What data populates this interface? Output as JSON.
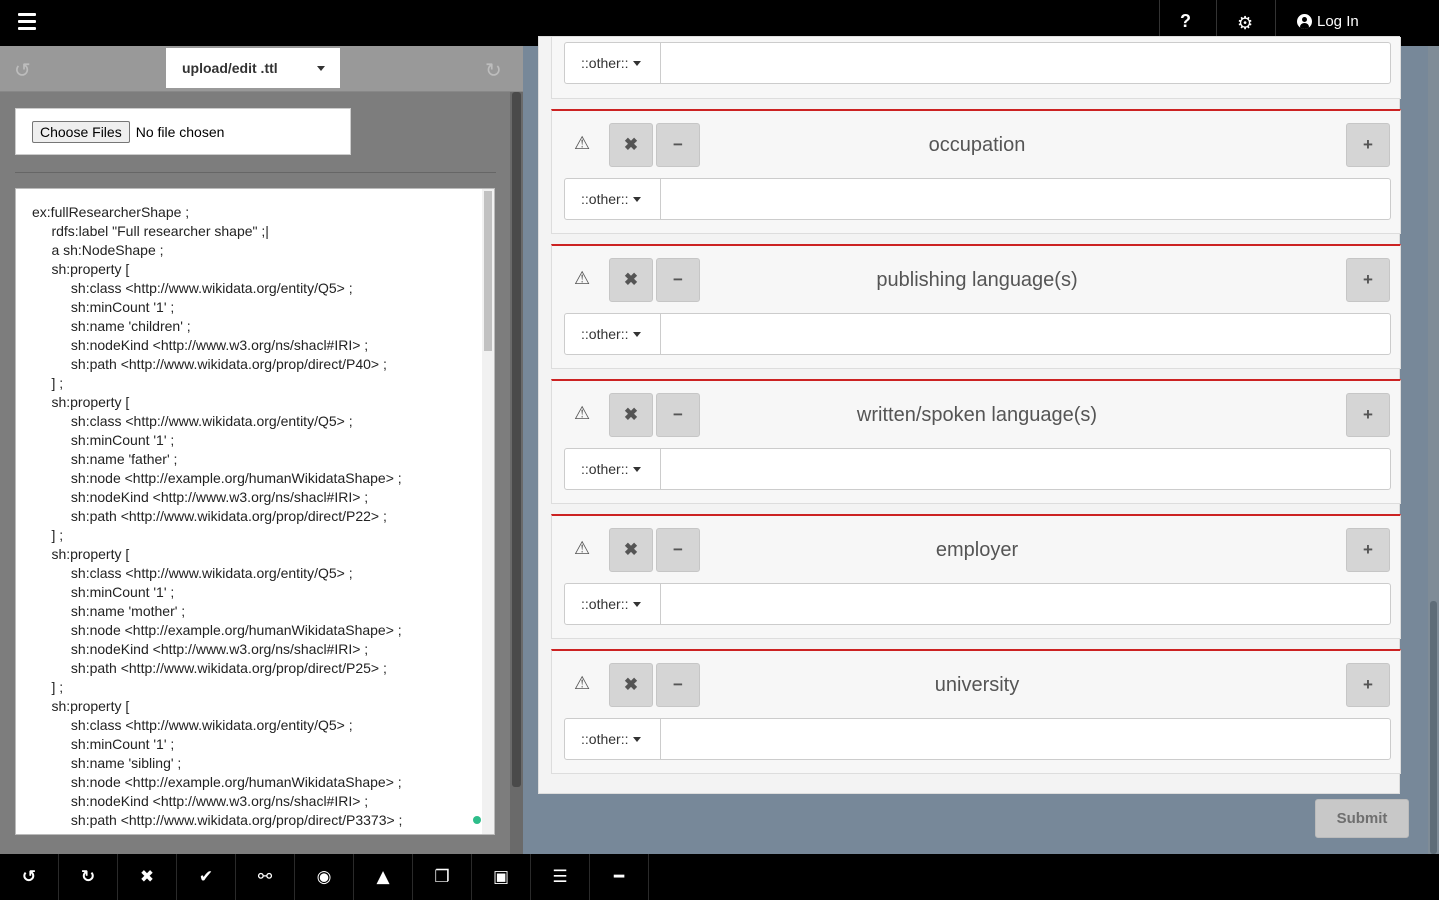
{
  "topbar": {
    "help_label": "?",
    "gear_icon": "⚙",
    "login_label": "Log In"
  },
  "left_panel": {
    "undo_icon": "↺",
    "redo_icon": "↻",
    "file_format": "upload/edit .ttl",
    "file_input_button": "Choose Files",
    "file_input_status": "No file chosen",
    "editor_text": "ex:fullResearcherShape ;\n\trdfs:label \"Full researcher shape\" ;|\n\ta sh:NodeShape ;\n\tsh:property [\n\t\tsh:class <http://www.wikidata.org/entity/Q5> ;\n\t\tsh:minCount '1' ;\n\t\tsh:name 'children' ;\n\t\tsh:nodeKind <http://www.w3.org/ns/shacl#IRI> ;\n\t\tsh:path <http://www.wikidata.org/prop/direct/P40> ;\n\t] ;\n\tsh:property [\n\t\tsh:class <http://www.wikidata.org/entity/Q5> ;\n\t\tsh:minCount '1' ;\n\t\tsh:name 'father' ;\n\t\tsh:node <http://example.org/humanWikidataShape> ;\n\t\tsh:nodeKind <http://www.w3.org/ns/shacl#IRI> ;\n\t\tsh:path <http://www.wikidata.org/prop/direct/P22> ;\n\t] ;\n\tsh:property [\n\t\tsh:class <http://www.wikidata.org/entity/Q5> ;\n\t\tsh:minCount '1' ;\n\t\tsh:name 'mother' ;\n\t\tsh:node <http://example.org/humanWikidataShape> ;\n\t\tsh:nodeKind <http://www.w3.org/ns/shacl#IRI> ;\n\t\tsh:path <http://www.wikidata.org/prop/direct/P25> ;\n\t] ;\n\tsh:property [\n\t\tsh:class <http://www.wikidata.org/entity/Q5> ;\n\t\tsh:minCount '1' ;\n\t\tsh:name 'sibling' ;\n\t\tsh:node <http://example.org/humanWikidataShape> ;\n\t\tsh:nodeKind <http://www.w3.org/ns/shacl#IRI> ;\n\t\tsh:path <http://www.wikidata.org/prop/direct/P3373> ;\n\t] ;"
  },
  "form": {
    "properties": [
      {
        "title": "",
        "dropdown": "::other::",
        "warn_icon": "⚠",
        "remove_icon": "✖",
        "minus_icon": "−",
        "plus_icon": "+"
      },
      {
        "title": "occupation",
        "dropdown": "::other::",
        "warn_icon": "⚠",
        "remove_icon": "✖",
        "minus_icon": "−",
        "plus_icon": "+"
      },
      {
        "title": "publishing language(s)",
        "dropdown": "::other::",
        "warn_icon": "⚠",
        "remove_icon": "✖",
        "minus_icon": "−",
        "plus_icon": "+"
      },
      {
        "title": "written/spoken language(s)",
        "dropdown": "::other::",
        "warn_icon": "⚠",
        "remove_icon": "✖",
        "minus_icon": "−",
        "plus_icon": "+"
      },
      {
        "title": "employer",
        "dropdown": "::other::",
        "warn_icon": "⚠",
        "remove_icon": "✖",
        "minus_icon": "−",
        "plus_icon": "+"
      },
      {
        "title": "university",
        "dropdown": "::other::",
        "warn_icon": "⚠",
        "remove_icon": "✖",
        "minus_icon": "−",
        "plus_icon": "+"
      }
    ],
    "submit_label": "Submit"
  },
  "bottombar": {
    "tools": [
      {
        "name": "undo-icon",
        "glyph": "↺"
      },
      {
        "name": "redo-icon",
        "glyph": "↻"
      },
      {
        "name": "clear-icon",
        "glyph": "✖"
      },
      {
        "name": "validate-check-icon",
        "glyph": "✔"
      },
      {
        "name": "link-icon",
        "glyph": "⚯"
      },
      {
        "name": "eye-icon",
        "glyph": "◉"
      },
      {
        "name": "road-icon",
        "glyph": "▲"
      },
      {
        "name": "copy-icon",
        "glyph": "❐"
      },
      {
        "name": "save-icon",
        "glyph": "▣"
      },
      {
        "name": "list-icon",
        "glyph": "☰"
      },
      {
        "name": "minimize-icon",
        "glyph": "━"
      }
    ]
  }
}
